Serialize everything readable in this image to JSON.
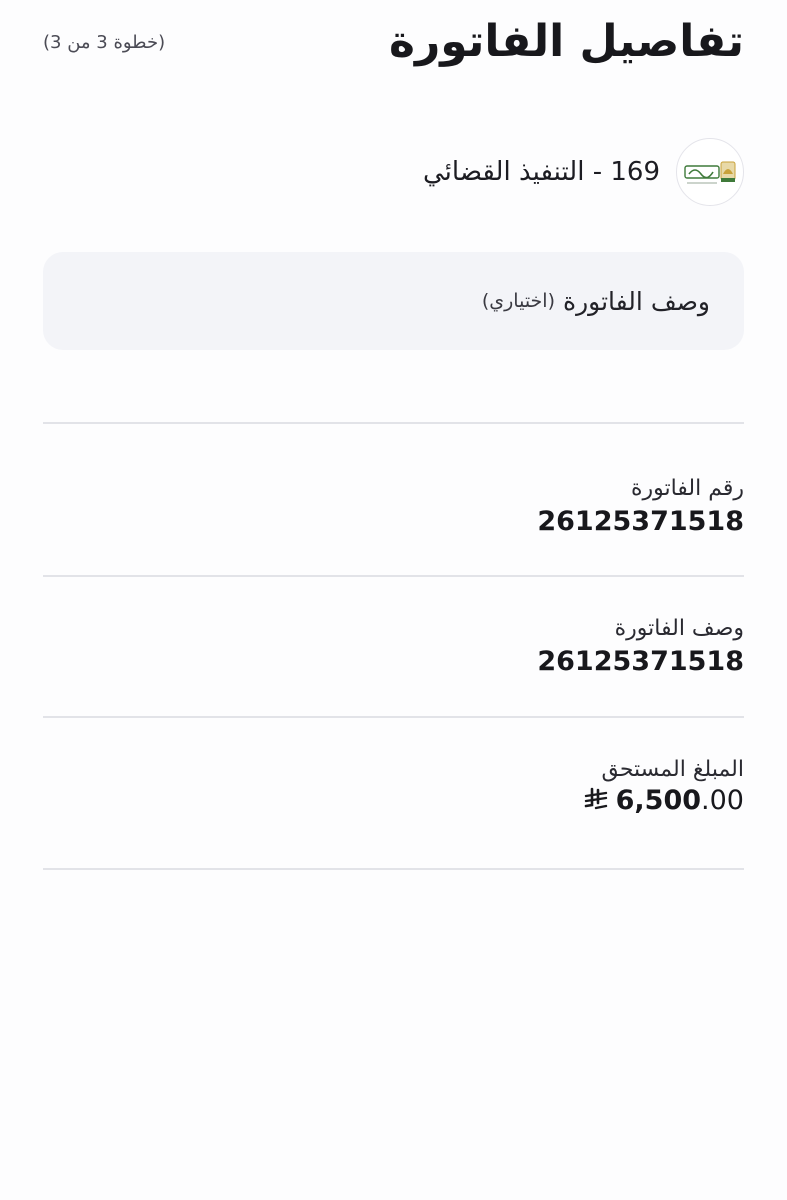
{
  "header": {
    "title": "تفاصيل الفاتورة",
    "step": "(خطوة 3 من 3)"
  },
  "biller": {
    "logo_icon": "ministry-of-justice-logo",
    "name": "169 - التنفيذ القضائي"
  },
  "description_field": {
    "label": "وصف الفاتورة",
    "optional": "(اختياري)"
  },
  "details": [
    {
      "label": "رقم الفاتورة",
      "value": "26125371518"
    },
    {
      "label": "وصف الفاتورة",
      "value": "26125371518"
    }
  ],
  "amount": {
    "label": "المبلغ المستحق",
    "integer": "6,500",
    "decimal": ".00",
    "currency_icon": "saudi-riyal-icon"
  },
  "colors": {
    "background": "#fdfdfe",
    "field_background": "#f3f4f8",
    "divider": "#e2e3e8",
    "logo_green": "#3f7a3a",
    "logo_gold": "#c9a23a"
  }
}
